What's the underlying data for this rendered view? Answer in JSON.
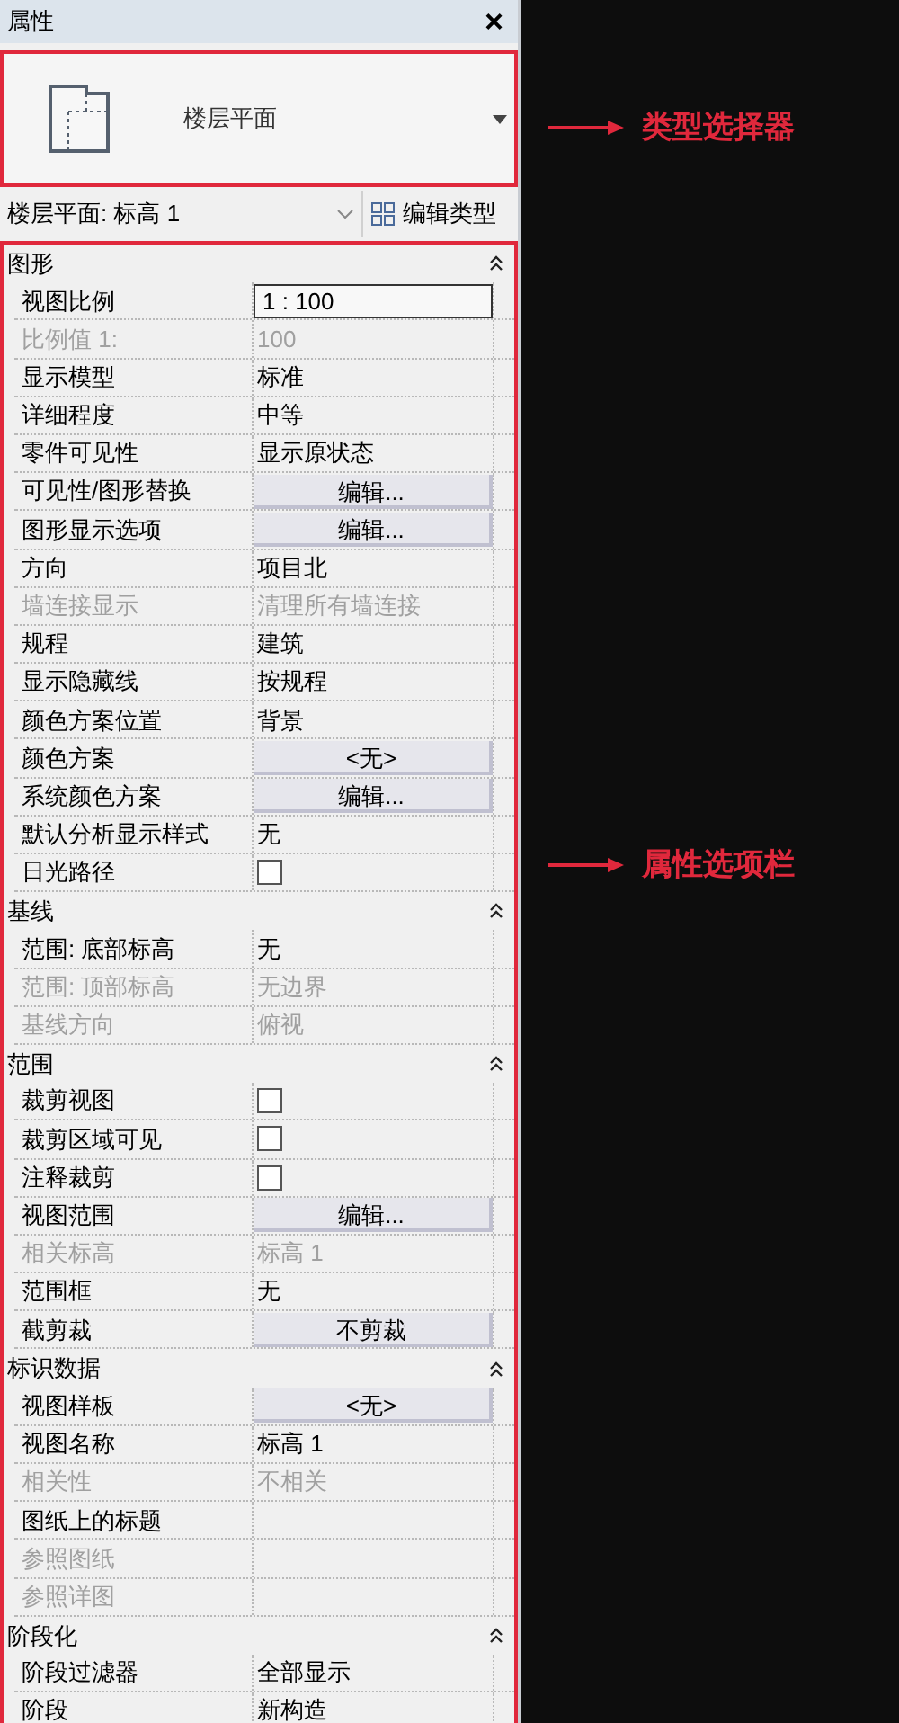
{
  "panel": {
    "title": "属性",
    "close": "×"
  },
  "type_selector": {
    "name": "楼层平面"
  },
  "instance_dropdown": {
    "value": "楼层平面: 标高 1"
  },
  "edit_type_button": "编辑类型",
  "sections": [
    {
      "title": "图形",
      "expanded": true,
      "rows": [
        {
          "label": "视图比例",
          "kind": "field",
          "value": "1 : 100",
          "disabled": false
        },
        {
          "label": "比例值 1:",
          "kind": "text",
          "value": "100",
          "disabled": true
        },
        {
          "label": "显示模型",
          "kind": "text",
          "value": "标准",
          "disabled": false
        },
        {
          "label": "详细程度",
          "kind": "text",
          "value": "中等",
          "disabled": false
        },
        {
          "label": "零件可见性",
          "kind": "text",
          "value": "显示原状态",
          "disabled": false
        },
        {
          "label": "可见性/图形替换",
          "kind": "button",
          "value": "编辑...",
          "disabled": false
        },
        {
          "label": "图形显示选项",
          "kind": "button",
          "value": "编辑...",
          "disabled": false
        },
        {
          "label": "方向",
          "kind": "text",
          "value": "项目北",
          "disabled": false
        },
        {
          "label": "墙连接显示",
          "kind": "text",
          "value": "清理所有墙连接",
          "disabled": true
        },
        {
          "label": "规程",
          "kind": "text",
          "value": "建筑",
          "disabled": false
        },
        {
          "label": "显示隐藏线",
          "kind": "text",
          "value": "按规程",
          "disabled": false
        },
        {
          "label": "颜色方案位置",
          "kind": "text",
          "value": "背景",
          "disabled": false
        },
        {
          "label": "颜色方案",
          "kind": "button",
          "value": "<无>",
          "disabled": false
        },
        {
          "label": "系统颜色方案",
          "kind": "button",
          "value": "编辑...",
          "disabled": false
        },
        {
          "label": "默认分析显示样式",
          "kind": "text",
          "value": "无",
          "disabled": false
        },
        {
          "label": "日光路径",
          "kind": "checkbox",
          "checked": false,
          "disabled": false
        }
      ]
    },
    {
      "title": "基线",
      "expanded": true,
      "rows": [
        {
          "label": "范围: 底部标高",
          "kind": "text",
          "value": "无",
          "disabled": false
        },
        {
          "label": "范围: 顶部标高",
          "kind": "text",
          "value": "无边界",
          "disabled": true
        },
        {
          "label": "基线方向",
          "kind": "text",
          "value": "俯视",
          "disabled": true
        }
      ]
    },
    {
      "title": "范围",
      "expanded": true,
      "rows": [
        {
          "label": "裁剪视图",
          "kind": "checkbox",
          "checked": false,
          "disabled": false
        },
        {
          "label": "裁剪区域可见",
          "kind": "checkbox",
          "checked": false,
          "disabled": false
        },
        {
          "label": "注释裁剪",
          "kind": "checkbox",
          "checked": false,
          "disabled": false
        },
        {
          "label": "视图范围",
          "kind": "button",
          "value": "编辑...",
          "disabled": false
        },
        {
          "label": "相关标高",
          "kind": "text",
          "value": "标高 1",
          "disabled": true
        },
        {
          "label": "范围框",
          "kind": "text",
          "value": "无",
          "disabled": false
        },
        {
          "label": "截剪裁",
          "kind": "button",
          "value": "不剪裁",
          "disabled": false
        }
      ]
    },
    {
      "title": "标识数据",
      "expanded": true,
      "rows": [
        {
          "label": "视图样板",
          "kind": "button",
          "value": "<无>",
          "disabled": false
        },
        {
          "label": "视图名称",
          "kind": "text",
          "value": "标高 1",
          "disabled": false
        },
        {
          "label": "相关性",
          "kind": "text",
          "value": "不相关",
          "disabled": true
        },
        {
          "label": "图纸上的标题",
          "kind": "text",
          "disabled": false
        },
        {
          "label": "参照图纸",
          "kind": "text",
          "disabled": true
        },
        {
          "label": "参照详图",
          "kind": "text",
          "disabled": true
        }
      ]
    },
    {
      "title": "阶段化",
      "expanded": true,
      "rows": [
        {
          "label": "阶段过滤器",
          "kind": "text",
          "value": "全部显示",
          "disabled": false
        },
        {
          "label": "阶段",
          "kind": "text",
          "value": "新构造",
          "disabled": false
        }
      ]
    }
  ],
  "annotations": [
    {
      "text": "类型选择器"
    },
    {
      "text": "属性选项栏"
    }
  ]
}
